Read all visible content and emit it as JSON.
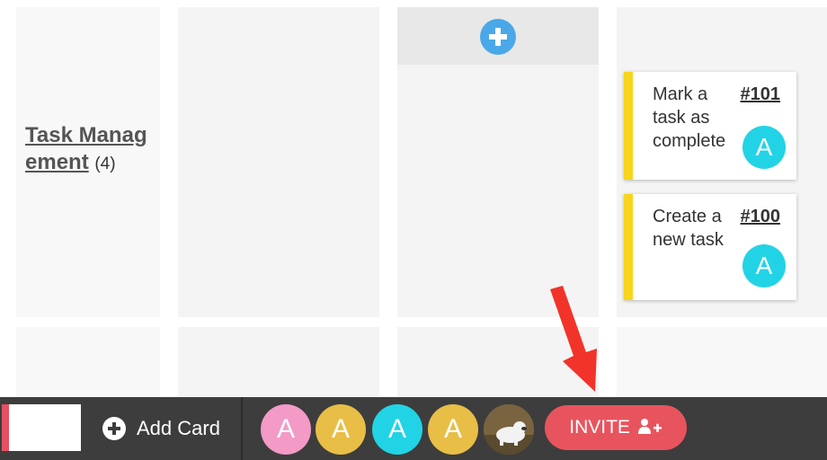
{
  "swimlane": {
    "title": "Task Management",
    "count": "(4)"
  },
  "cards": [
    {
      "title": "Mark a task as complete",
      "id": "#101",
      "avatar": "A"
    },
    {
      "title": "Create a new task",
      "id": "#100",
      "avatar": "A"
    }
  ],
  "toolbar": {
    "add_card_label": "Add Card",
    "invite_label": "INVITE",
    "avatars": [
      {
        "letter": "A",
        "color": "#f39ac7"
      },
      {
        "letter": "A",
        "color": "#e8be47"
      },
      {
        "letter": "A",
        "color": "#22d3e6"
      },
      {
        "letter": "A",
        "color": "#e8be47"
      }
    ]
  },
  "colors": {
    "card_accent": "#f7d51d",
    "invite": "#e8545e",
    "add_button": "#4aa8e8"
  }
}
